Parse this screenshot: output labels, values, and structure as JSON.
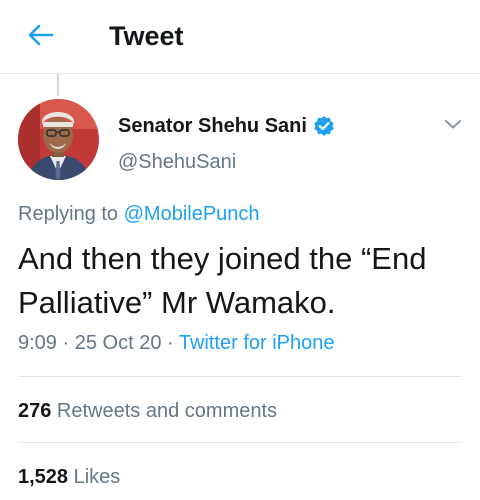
{
  "header": {
    "title": "Tweet"
  },
  "tweet": {
    "display_name": "Senator Shehu Sani",
    "handle": "@ShehuSani",
    "replying_prefix": "Replying to ",
    "replying_to": "@MobilePunch",
    "text": "And then they joined the “End Palliative” Mr Wamako.",
    "time": "9:09",
    "date": "25 Oct 20",
    "separator": " · ",
    "source": "Twitter for iPhone"
  },
  "stats": {
    "retweets_count": "276",
    "retweets_label": " Retweets and comments",
    "likes_count": "1,528",
    "likes_label": " Likes"
  },
  "colors": {
    "accent": "#1da1f2",
    "text": "#14171a",
    "secondary": "#657786",
    "divider": "#e1e8ed"
  }
}
